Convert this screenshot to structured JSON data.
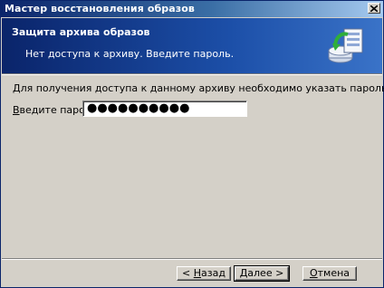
{
  "window": {
    "title": "Мастер восстановления образов"
  },
  "header": {
    "title": "Защита архива образов",
    "subtitle": "Нет доступа к архиву. Введите пароль.",
    "icon": "backup-restore-icon"
  },
  "content": {
    "description": "Для получения доступа к данному архиву необходимо указать пароль.",
    "password_label": "Введите пароль:",
    "password_value_masked": "●●●●●●●●●●"
  },
  "buttons": {
    "back_prefix": "< ",
    "back_hotkey": "Н",
    "back_rest": "азад",
    "next_hotkey": "Д",
    "next_rest": "алее >",
    "cancel_hotkey": "О",
    "cancel_rest": "тмена"
  },
  "colors": {
    "title_bar": "#0a246a",
    "header_bg": "#1c4fa8",
    "dialog_bg": "#d4d0c8"
  }
}
